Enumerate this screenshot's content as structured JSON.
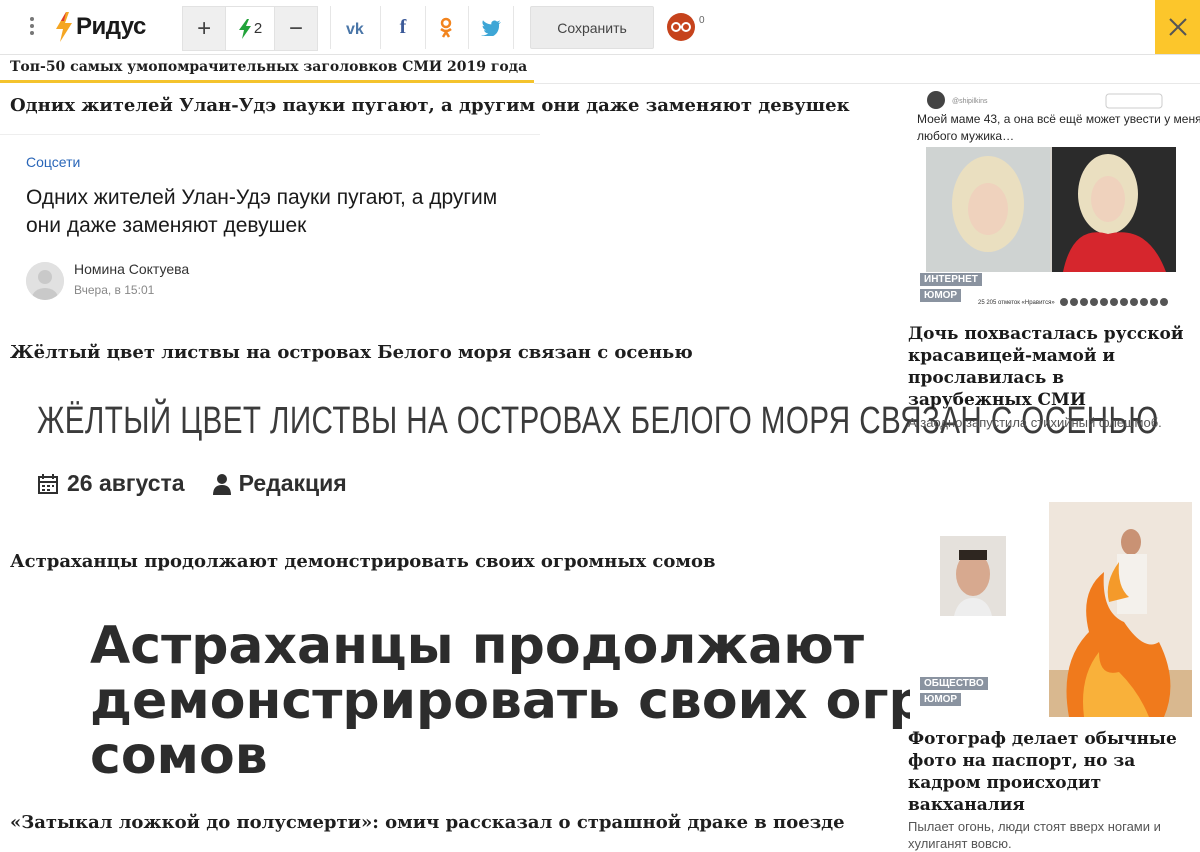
{
  "toolbar": {
    "logo": "Ридус",
    "vote_plus": "+",
    "vote_count": "2",
    "vote_minus": "−",
    "share_vk": "vk",
    "share_fb": "f",
    "share_ok": "ok",
    "save_label": "Сохранить",
    "badge_count": "0",
    "accent_color": "#fcc62b",
    "close_icon": "close-icon"
  },
  "collection": {
    "title": "Топ-50 самых умопомрачительных заголовков СМИ 2019 года"
  },
  "items": [
    {
      "headline": "Одних жителей Улан-Удэ пауки пугают, а другим они даже заменяют девушек",
      "card": {
        "category": "Соцсети",
        "title": "Одних жителей Улан-Удэ пауки пугают, а другим они даже заменяют девушек",
        "author": "Номина Соктуева",
        "date": "Вчера, в 15:01"
      }
    },
    {
      "headline": "Жёлтый цвет листвы на островах Белого моря связан с осенью",
      "big_title": "ЖЁЛТЫЙ ЦВЕТ ЛИСТВЫ НА ОСТРОВАХ БЕЛОГО МОРЯ СВЯЗАН С ОСЕНЬЮ",
      "date": "26 августа",
      "author": "Редакция"
    },
    {
      "headline": "Астраханцы продолжают демонстрировать своих огромных сомов",
      "big_lines": [
        "Астраханцы продолжают",
        "демонстрировать своих огром",
        "сомов"
      ]
    },
    {
      "headline": "«Затыкал ложкой до полусмерти»: омич рассказал о страшной драке в поезде"
    }
  ],
  "sidebar": [
    {
      "post_user": "@shipilkins",
      "post_text": "Моей маме 43, а она всё ещё может увести у меня любого мужика…",
      "post_likes": "25 205 отметок «Нравится»",
      "tags": [
        "ИНТЕРНЕТ",
        "ЮМОР"
      ],
      "title": "Дочь похвасталась русской красавицей-мамой и прославилась в зарубежных СМИ",
      "desc": "А заодно запустила стихийный флешмоб."
    },
    {
      "tags": [
        "ОБЩЕСТВО",
        "ЮМОР"
      ],
      "title": "Фотограф делает обычные фото на паспорт, но за кадром происходит вакханалия",
      "desc": "Пылает огонь, люди стоят вверх ногами и хулиганят вовсю."
    }
  ]
}
